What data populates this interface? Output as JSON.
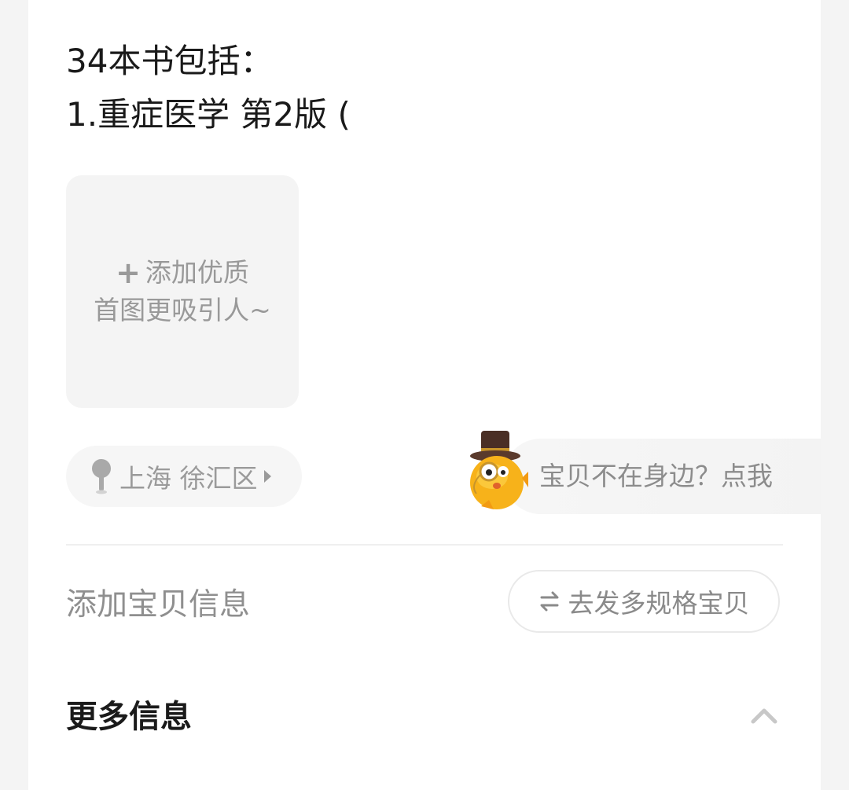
{
  "description": {
    "line1": "34本书包括：",
    "line2": "1.重症医学 第2版 ("
  },
  "add_image": {
    "plus": "+",
    "line1": "添加优质",
    "line2": "首图更吸引人~"
  },
  "location": {
    "icon": "location-pin-icon",
    "label": "上海 徐汇区"
  },
  "helper": {
    "mascot": "mascot-icon",
    "text": "宝贝不在身边？点我"
  },
  "add_info": {
    "label": "添加宝贝信息"
  },
  "multi_spec": {
    "icon": "swap-icon",
    "label": "去发多规格宝贝"
  },
  "more_info": {
    "title": "更多信息",
    "icon": "chevron-up-icon"
  },
  "colors": {
    "background": "#f4f4f4",
    "card": "#ffffff",
    "text_primary": "#1a1a1a",
    "text_secondary": "#999999",
    "mascot_yellow": "#f7b21a"
  }
}
